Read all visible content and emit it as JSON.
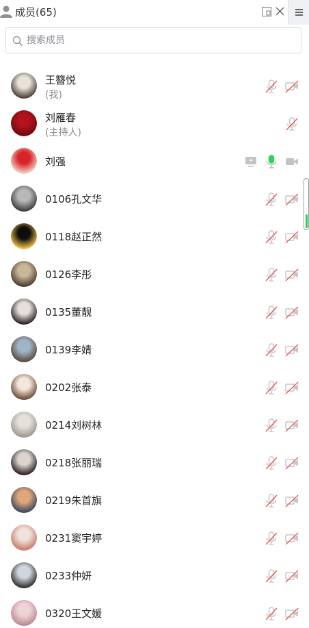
{
  "header": {
    "title": "成员(65)"
  },
  "search": {
    "placeholder": "搜索成员"
  },
  "members": [
    {
      "name": "王簪悦",
      "role": "(我)",
      "mic": "muted",
      "cam": "off",
      "share": false,
      "avatar_colors": [
        "#e8e2d8",
        "#4a3f37"
      ]
    },
    {
      "name": "刘雁春",
      "role": "(主持人)",
      "mic": "muted",
      "cam": "none",
      "share": false,
      "avatar_colors": [
        "#b3131b",
        "#6e0b10"
      ]
    },
    {
      "name": "刘强",
      "role": "",
      "mic": "active",
      "cam": "on-gray",
      "share": true,
      "avatar_colors": [
        "#d9232a",
        "#f2d2c2"
      ]
    },
    {
      "name": "0106孔文华",
      "role": "",
      "mic": "muted",
      "cam": "off",
      "share": false,
      "avatar_colors": [
        "#b8b8b8",
        "#3d3d3d"
      ]
    },
    {
      "name": "0118赵正然",
      "role": "",
      "mic": "muted",
      "cam": "off",
      "share": false,
      "avatar_colors": [
        "#0d0d0d",
        "#f6c14a"
      ]
    },
    {
      "name": "0126李彤",
      "role": "",
      "mic": "muted",
      "cam": "off",
      "share": false,
      "avatar_colors": [
        "#c9b79a",
        "#4b3b2c"
      ]
    },
    {
      "name": "0135董靓",
      "role": "",
      "mic": "muted",
      "cam": "off",
      "share": false,
      "avatar_colors": [
        "#e6e0dc",
        "#2a2222"
      ]
    },
    {
      "name": "0139李婧",
      "role": "",
      "mic": "muted",
      "cam": "off",
      "share": false,
      "avatar_colors": [
        "#9fb4c8",
        "#5a4a3a"
      ]
    },
    {
      "name": "0202张泰",
      "role": "",
      "mic": "muted",
      "cam": "off",
      "share": false,
      "avatar_colors": [
        "#f3e6da",
        "#6b4a3a"
      ]
    },
    {
      "name": "0214刘树林",
      "role": "",
      "mic": "muted",
      "cam": "off",
      "share": false,
      "avatar_colors": [
        "#e4e1dc",
        "#9d978f"
      ]
    },
    {
      "name": "0218张丽瑞",
      "role": "",
      "mic": "muted",
      "cam": "off",
      "share": false,
      "avatar_colors": [
        "#ddd4cf",
        "#2b2020"
      ]
    },
    {
      "name": "0219朱首旗",
      "role": "",
      "mic": "muted",
      "cam": "off",
      "share": false,
      "avatar_colors": [
        "#e0a77a",
        "#3b4660"
      ]
    },
    {
      "name": "0231窦宇婷",
      "role": "",
      "mic": "muted",
      "cam": "off",
      "share": false,
      "avatar_colors": [
        "#efe2dc",
        "#c87b6a"
      ]
    },
    {
      "name": "0233仲妍",
      "role": "",
      "mic": "muted",
      "cam": "off",
      "share": false,
      "avatar_colors": [
        "#cfd6dd",
        "#2f2f2f"
      ]
    },
    {
      "name": "0320王文媛",
      "role": "",
      "mic": "muted",
      "cam": "off",
      "share": false,
      "avatar_colors": [
        "#f0d3d6",
        "#b98a8f"
      ]
    }
  ]
}
